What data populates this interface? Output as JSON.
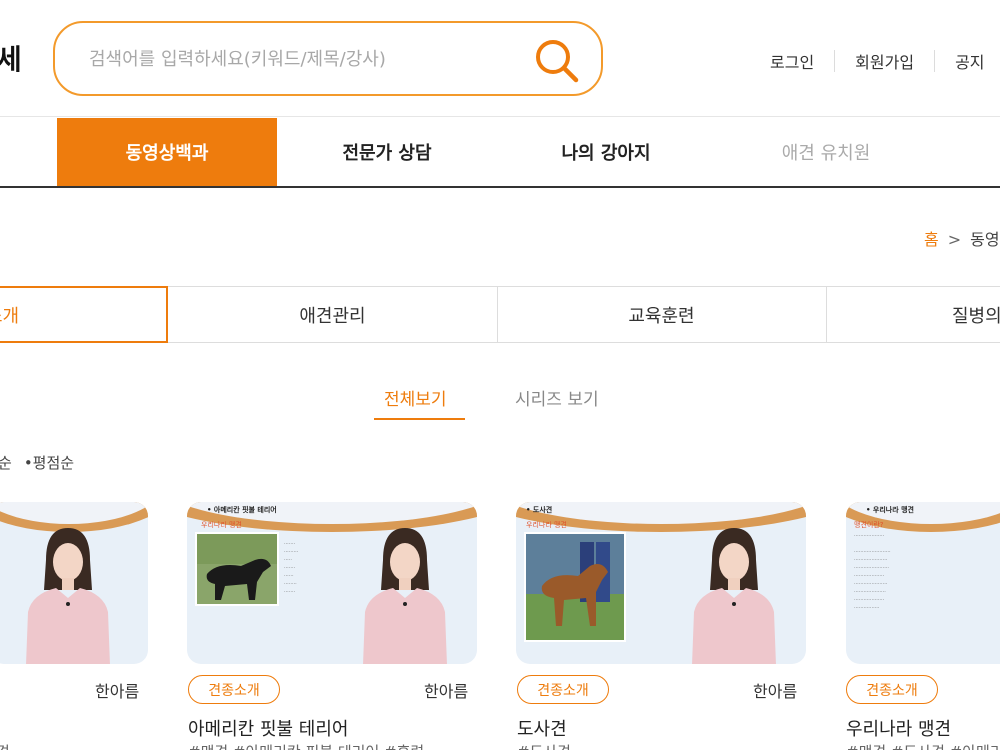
{
  "header": {
    "logo_fragment": "세",
    "search_placeholder": "검색어를 입력하세요(키워드/제목/강사)",
    "util_links": [
      "로그인",
      "회원가입",
      "공지"
    ]
  },
  "gnb": [
    "동영상백과",
    "전문가 상담",
    "나의 강아지",
    "애견 유치원"
  ],
  "breadcrumb": {
    "home": "홈",
    "sep": ">",
    "current": "동영"
  },
  "categories": [
    "소개",
    "애견관리",
    "교육훈련",
    "질병의"
  ],
  "view_tabs": [
    "전체보기",
    "시리즈 보기"
  ],
  "sort": [
    "순",
    "•평점순"
  ],
  "cards": [
    {
      "badge": "",
      "teacher": "한아름",
      "title": "",
      "tags": "견"
    },
    {
      "badge": "견종소개",
      "teacher": "한아름",
      "title": "아메리칸 핏불 테리어",
      "tags": "#맹견 #아메리칸 핏불 테리어 #훈련",
      "slide_title": "• 아메리칸 핏불 테리어",
      "slide_sub": "우리나라 맹견"
    },
    {
      "badge": "견종소개",
      "teacher": "한아름",
      "title": "도사견",
      "tags": "#도사견",
      "slide_title": "• 도사견",
      "slide_sub": "우리나라 맹견"
    },
    {
      "badge": "견종소개",
      "teacher": "",
      "title": "우리나라 맹견",
      "tags": "#맹견 #도사견 #아메리",
      "slide_title": "• 우리나라 맹견",
      "slide_sub": "맹견이란?"
    }
  ],
  "colors": {
    "accent": "#ee7c0d",
    "search_border": "#f39a2b"
  }
}
